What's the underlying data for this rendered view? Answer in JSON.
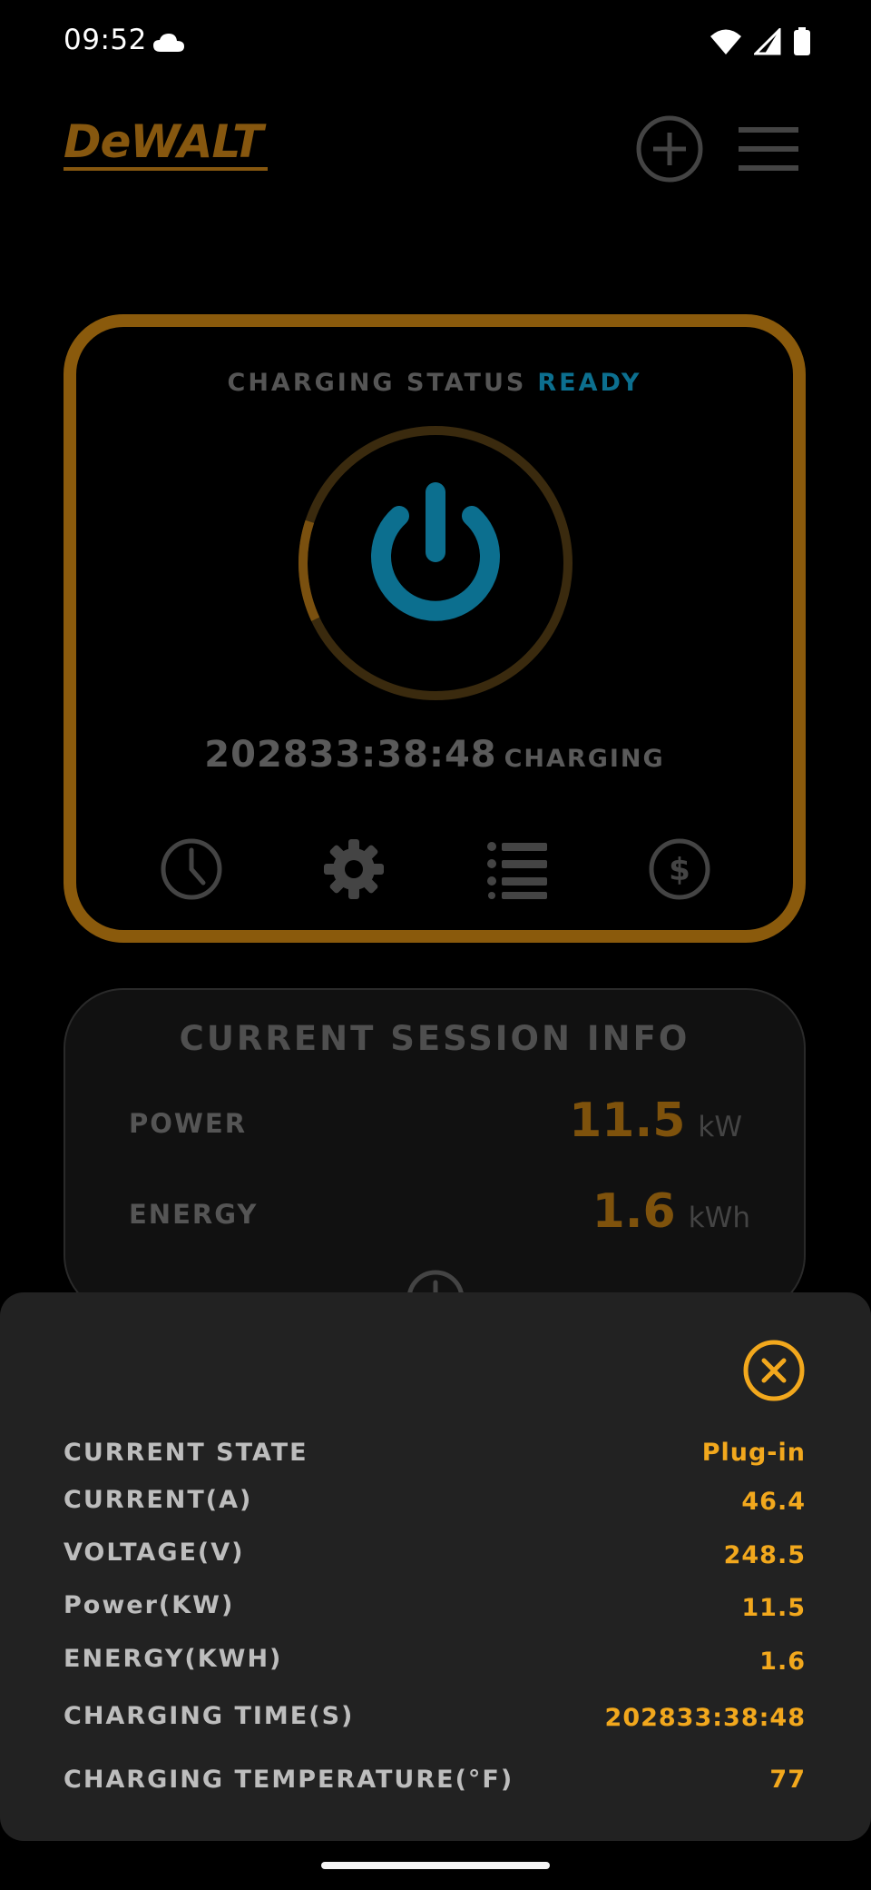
{
  "status_bar": {
    "time": "09:52"
  },
  "header": {
    "logo_text": "DeWALT"
  },
  "charging_card": {
    "status_label": "CHARGING STATUS",
    "status_value": "READY",
    "elapsed_time": "202833:38:48",
    "state_text": "CHARGING",
    "ring_progress": 0.12
  },
  "session_info": {
    "title": "CURRENT SESSION INFO",
    "rows": [
      {
        "label": "POWER",
        "value": "11.5",
        "unit": "kW"
      },
      {
        "label": "ENERGY",
        "value": "1.6",
        "unit": "kWh"
      }
    ]
  },
  "details": {
    "rows": [
      {
        "label": "CURRENT STATE",
        "value": "Plug-in"
      },
      {
        "label": "CURRENT(A)",
        "value": "46.4"
      },
      {
        "label": "VOLTAGE(V)",
        "value": "248.5"
      },
      {
        "label": "Power(KW)",
        "value": "11.5"
      },
      {
        "label": "ENERGY(KWH)",
        "value": "1.6"
      },
      {
        "label": "CHARGING TIME(S)",
        "value": "202833:38:48"
      },
      {
        "label": "CHARGING TEMPERATURE(°F)",
        "value": "77"
      }
    ]
  },
  "colors": {
    "accent_gold": "#8a5a0c",
    "value_orange": "#f2a81d",
    "ready_blue": "#0c6f8f",
    "sheet_bg": "#222222"
  },
  "icons": {
    "status_bar": [
      "cloud-icon",
      "wifi-icon",
      "signal-icon",
      "battery-icon"
    ],
    "header": [
      "add-circle-icon",
      "hamburger-menu-icon"
    ],
    "card": [
      "clock-icon",
      "gear-icon",
      "list-icon",
      "dollar-icon"
    ]
  }
}
